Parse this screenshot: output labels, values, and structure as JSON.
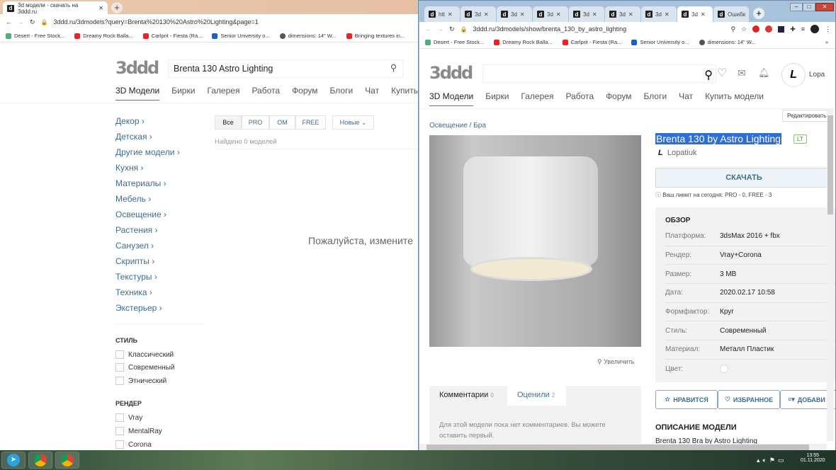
{
  "left_browser": {
    "tab_title": "3d модели - скачать на 3ddd.ru",
    "url": "3ddd.ru/3dmodels?query=Brenta%20130%20Astro%20Lighting&page=1",
    "bookmarks": [
      "Desert - Free Stock...",
      "Dreamy Rock Balla...",
      "Carlprit - Fiesta (Ra...",
      "Senior University o...",
      "dimensions: 14\" W...",
      "Bringing textures in..."
    ],
    "logo": "3ddd",
    "search_value": "Brenta 130 Astro Lighting",
    "nav": [
      "3D Модели",
      "Бирки",
      "Галерея",
      "Работа",
      "Форум",
      "Блоги",
      "Чат",
      "Купить модели"
    ],
    "categories": [
      "Декор ›",
      "Детская ›",
      "Другие модели ›",
      "Кухня ›",
      "Материалы ›",
      "Мебель ›",
      "Освещение ›",
      "Растения ›",
      "Санузел ›",
      "Скрипты ›",
      "Текстуры ›",
      "Техника ›",
      "Экстерьер ›"
    ],
    "style_heading": "СТИЛЬ",
    "styles": [
      "Классический",
      "Современный",
      "Этнический"
    ],
    "render_heading": "РЕНДЕР",
    "renders": [
      "Vray",
      "MentalRay",
      "Corona"
    ],
    "filters": [
      "Все",
      "PRO",
      "OM",
      "FREE"
    ],
    "sort": "Новые ⌄",
    "found": "Найдено 0 моделей",
    "empty_message": "Пожалуйста, измените"
  },
  "right_browser": {
    "tabs": [
      "htt",
      "3d",
      "3d",
      "3d",
      "3d",
      "3d",
      "3d",
      "3d",
      "Ошибк"
    ],
    "url": "3ddd.ru/3dmodels/show/brenta_130_by_astro_lighting",
    "bookmarks": [
      "Desert - Free Stock...",
      "Dreamy Rock Balla...",
      "Carlprit - Fiesta (Ra...",
      "Senior University o...",
      "dimensions: 14\" W..."
    ],
    "more_bookmarks": "»",
    "logo": "3ddd",
    "user": "Lopa",
    "nav": [
      "3D Модели",
      "Бирки",
      "Галерея",
      "Работа",
      "Форум",
      "Блоги",
      "Чат",
      "Купить модели"
    ],
    "edit_button": "Редактировать",
    "breadcrumb": [
      "Освещение",
      "/",
      "Бра"
    ],
    "title": "Brenta 130 by Astro Lighting",
    "badge": "LT",
    "author": "Lopatiuk",
    "download": "СКАЧАТЬ",
    "limit": "Ваш лимит на сегодня: PRO - 0, FREE - 3",
    "overview_heading": "ОБЗОР",
    "specs": [
      {
        "k": "Платформа:",
        "v": "3dsMax 2016 + fbx"
      },
      {
        "k": "Рендер:",
        "v": "Vray+Corona"
      },
      {
        "k": "Размер:",
        "v": "3 MB"
      },
      {
        "k": "Дата:",
        "v": "2020.02.17 10:58"
      },
      {
        "k": "Формфактор:",
        "v": "Круг"
      },
      {
        "k": "Стиль:",
        "v": "Современный"
      },
      {
        "k": "Материал:",
        "v": "Металл Пластик"
      },
      {
        "k": "Цвет:",
        "v": ""
      }
    ],
    "like": "НРАВИТСЯ",
    "favorite": "ИЗБРАННОЕ",
    "add": "ДОБАВИ",
    "zoom": "Увеличить",
    "comments_tab": "Комментарии",
    "comments_count": "0",
    "rated_tab": "Оценили",
    "rated_count": "2",
    "no_comments": "Для этой модели пока нет комментариев. Вы можете оставить первый.",
    "description_heading": "ОПИСАНИЕ МОДЕЛИ",
    "description": "Brenta 130 Bra by Astro Lighting"
  },
  "taskbar": {
    "time": "13:55",
    "date": "01.11.2020"
  }
}
